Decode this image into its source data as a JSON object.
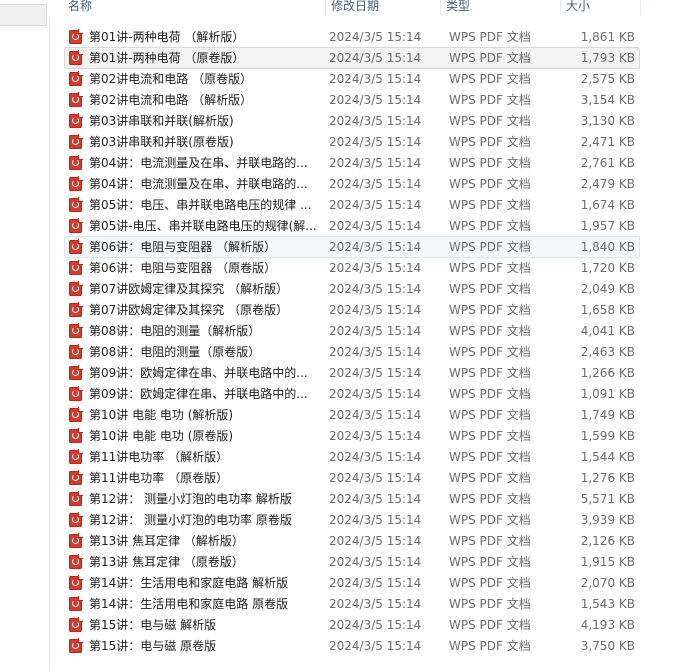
{
  "columns": {
    "name": "名称",
    "date": "修改日期",
    "type": "类型",
    "size": "大小"
  },
  "file_icon": "pdf-file-icon",
  "files": [
    {
      "name": "第01讲-两种电荷 （解析版）",
      "date": "2024/3/5 15:14",
      "type": "WPS PDF 文档",
      "size": "1,861 KB"
    },
    {
      "name": "第01讲-两种电荷 （原卷版）",
      "date": "2024/3/5 15:14",
      "type": "WPS PDF 文档",
      "size": "1,793 KB"
    },
    {
      "name": "第02讲电流和电路 （原卷版）",
      "date": "2024/3/5 15:14",
      "type": "WPS PDF 文档",
      "size": "2,575 KB"
    },
    {
      "name": "第02讲电流和电路 （解析版）",
      "date": "2024/3/5 15:14",
      "type": "WPS PDF 文档",
      "size": "3,154 KB"
    },
    {
      "name": "第03讲串联和并联(解析版)",
      "date": "2024/3/5 15:14",
      "type": "WPS PDF 文档",
      "size": "3,130 KB"
    },
    {
      "name": "第03讲串联和并联(原卷版)",
      "date": "2024/3/5 15:14",
      "type": "WPS PDF 文档",
      "size": "2,471 KB"
    },
    {
      "name": "第04讲：电流测量及在串、并联电路的...",
      "date": "2024/3/5 15:14",
      "type": "WPS PDF 文档",
      "size": "2,761 KB"
    },
    {
      "name": "第04讲：电流测量及在串、并联电路的...",
      "date": "2024/3/5 15:14",
      "type": "WPS PDF 文档",
      "size": "2,479 KB"
    },
    {
      "name": "第05讲：电压、串并联电路电压的规律 ...",
      "date": "2024/3/5 15:14",
      "type": "WPS PDF 文档",
      "size": "1,674 KB"
    },
    {
      "name": "第05讲-电压、串并联电路电压的规律(解...",
      "date": "2024/3/5 15:14",
      "type": "WPS PDF 文档",
      "size": "1,957 KB"
    },
    {
      "name": "第06讲：电阻与变阻器 （解析版）",
      "date": "2024/3/5 15:14",
      "type": "WPS PDF 文档",
      "size": "1,840 KB"
    },
    {
      "name": "第06讲：电阻与变阻器 （原卷版）",
      "date": "2024/3/5 15:14",
      "type": "WPS PDF 文档",
      "size": "1,720 KB"
    },
    {
      "name": "第07讲欧姆定律及其探究 （解析版）",
      "date": "2024/3/5 15:14",
      "type": "WPS PDF 文档",
      "size": "2,049 KB"
    },
    {
      "name": "第07讲欧姆定律及其探究 （原卷版）",
      "date": "2024/3/5 15:14",
      "type": "WPS PDF 文档",
      "size": "1,658 KB"
    },
    {
      "name": "第08讲：电阻的测量（解析版）",
      "date": "2024/3/5 15:14",
      "type": "WPS PDF 文档",
      "size": "4,041 KB"
    },
    {
      "name": "第08讲：电阻的测量（原卷版）",
      "date": "2024/3/5 15:14",
      "type": "WPS PDF 文档",
      "size": "2,463 KB"
    },
    {
      "name": "第09讲：欧姆定律在串、并联电路中的...",
      "date": "2024/3/5 15:14",
      "type": "WPS PDF 文档",
      "size": "1,266 KB"
    },
    {
      "name": "第09讲：欧姆定律在串、并联电路中的...",
      "date": "2024/3/5 15:14",
      "type": "WPS PDF 文档",
      "size": "1,091 KB"
    },
    {
      "name": "第10讲 电能 电功 (解析版)",
      "date": "2024/3/5 15:14",
      "type": "WPS PDF 文档",
      "size": "1,749 KB"
    },
    {
      "name": "第10讲 电能 电功 (原卷版)",
      "date": "2024/3/5 15:14",
      "type": "WPS PDF 文档",
      "size": "1,599 KB"
    },
    {
      "name": "第11讲电功率 （解析版）",
      "date": "2024/3/5 15:14",
      "type": "WPS PDF 文档",
      "size": "1,544 KB"
    },
    {
      "name": "第11讲电功率 （原卷版）",
      "date": "2024/3/5 15:14",
      "type": "WPS PDF 文档",
      "size": "1,276 KB"
    },
    {
      "name": "第12讲： 测量小灯泡的电功率 解析版",
      "date": "2024/3/5 15:14",
      "type": "WPS PDF 文档",
      "size": "5,571 KB"
    },
    {
      "name": "第12讲： 测量小灯泡的电功率 原卷版",
      "date": "2024/3/5 15:14",
      "type": "WPS PDF 文档",
      "size": "3,939 KB"
    },
    {
      "name": "第13讲 焦耳定律 （解析版）",
      "date": "2024/3/5 15:14",
      "type": "WPS PDF 文档",
      "size": "2,126 KB"
    },
    {
      "name": "第13讲 焦耳定律 （原卷版）",
      "date": "2024/3/5 15:14",
      "type": "WPS PDF 文档",
      "size": "1,915 KB"
    },
    {
      "name": "第14讲：生活用电和家庭电路 解析版",
      "date": "2024/3/5 15:14",
      "type": "WPS PDF 文档",
      "size": "2,070 KB"
    },
    {
      "name": "第14讲：生活用电和家庭电路 原卷版",
      "date": "2024/3/5 15:14",
      "type": "WPS PDF 文档",
      "size": "1,543 KB"
    },
    {
      "name": "第15讲：电与磁 解析版",
      "date": "2024/3/5 15:14",
      "type": "WPS PDF 文档",
      "size": "4,193 KB"
    },
    {
      "name": "第15讲：电与磁 原卷版",
      "date": "2024/3/5 15:14",
      "type": "WPS PDF 文档",
      "size": "3,750 KB"
    }
  ]
}
